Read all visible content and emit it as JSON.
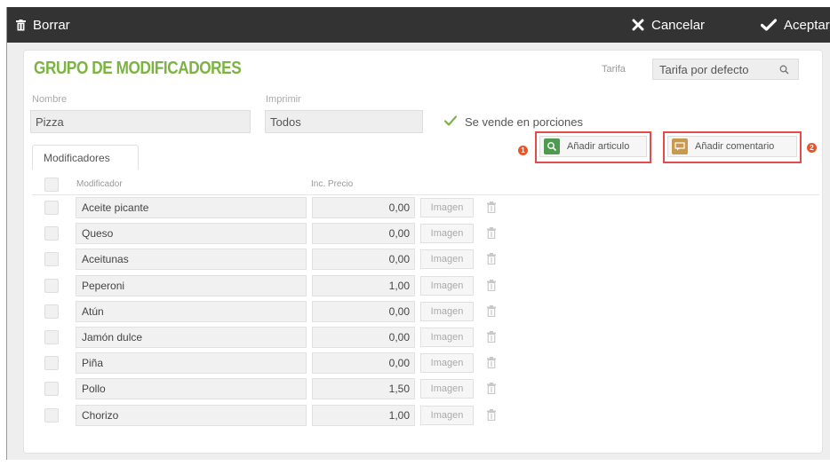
{
  "toolbar": {
    "delete_label": "Borrar",
    "cancel_label": "Cancelar",
    "accept_label": "Aceptar"
  },
  "page": {
    "title": "GRUPO DE MODIFICADORES"
  },
  "tarifa": {
    "label": "Tarifa",
    "value": "Tarifa por defecto"
  },
  "form": {
    "nombre_label": "Nombre",
    "nombre_value": "Pizza",
    "imprimir_label": "Imprimir",
    "imprimir_value": "Todos",
    "porciones_label": "Se vende en porciones",
    "porciones_checked": true
  },
  "tabs": {
    "modificadores": "Modificadores"
  },
  "actions": {
    "add_article_label": "Añadir articulo",
    "add_article_marker": "1",
    "add_comment_label": "Añadir comentario",
    "add_comment_marker": "2"
  },
  "table": {
    "col_modifier": "Modificador",
    "col_price": "Inc. Precio",
    "image_button_label": "Imagen",
    "rows": [
      {
        "name": "Aceite picante",
        "price": "0,00"
      },
      {
        "name": "Queso",
        "price": "0,00"
      },
      {
        "name": "Aceitunas",
        "price": "0,00"
      },
      {
        "name": "Peperoni",
        "price": "1,00"
      },
      {
        "name": "Atún",
        "price": "0,00"
      },
      {
        "name": "Jamón dulce",
        "price": "0,00"
      },
      {
        "name": "Piña",
        "price": "0,00"
      },
      {
        "name": "Pollo",
        "price": "1,50"
      },
      {
        "name": "Chorizo",
        "price": "1,00"
      }
    ]
  },
  "colors": {
    "accent_green": "#7cb342",
    "toolbar_bg": "#333333",
    "highlight_red": "#e24c4c",
    "marker_orange": "#e8552a"
  },
  "icons": {
    "delete": "trash-icon",
    "cancel": "close-icon",
    "accept": "checkmark-icon",
    "search": "search-icon",
    "add_article": "magnifier-icon",
    "add_comment": "comment-icon"
  }
}
